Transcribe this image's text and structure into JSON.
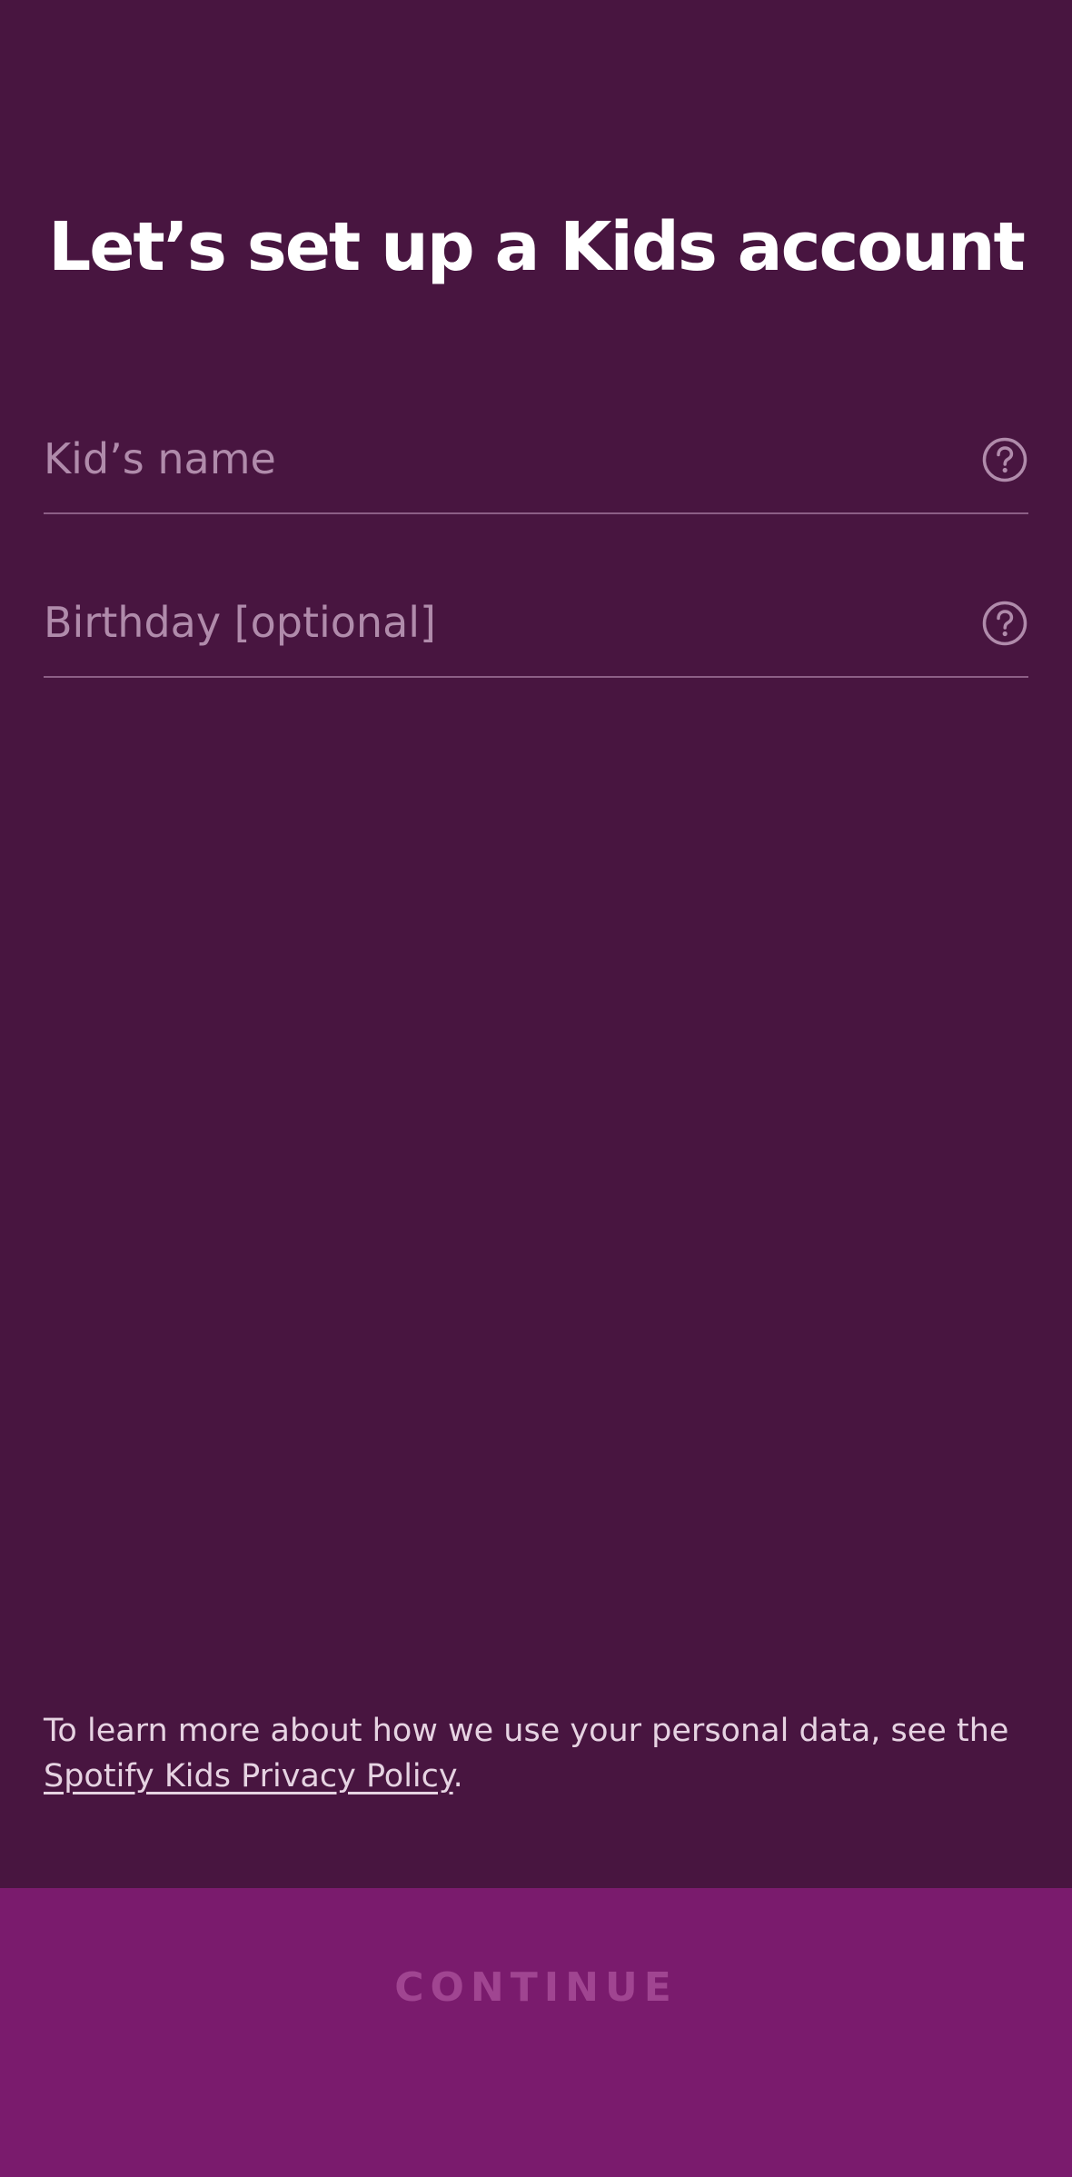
{
  "page": {
    "title": "Let’s set up a Kids account"
  },
  "form": {
    "name_field": {
      "placeholder": "Kid’s name",
      "value": ""
    },
    "birthday_field": {
      "placeholder": "Birthday [optional]",
      "value": ""
    },
    "help_icon": "question-circle-icon"
  },
  "privacy": {
    "text_before": "To learn more about how we use your personal data, see the ",
    "link_label": "Spotify Kids Privacy Policy",
    "text_after": "."
  },
  "footer": {
    "continue_label": "CONTINUE",
    "continue_enabled": false
  },
  "colors": {
    "background": "#481540",
    "footer_background": "#7a1b6d",
    "title_text": "#ffffff",
    "placeholder_text": "#b08bab",
    "field_underline": "#8c5f86",
    "disabled_button_text": "#a04591"
  }
}
